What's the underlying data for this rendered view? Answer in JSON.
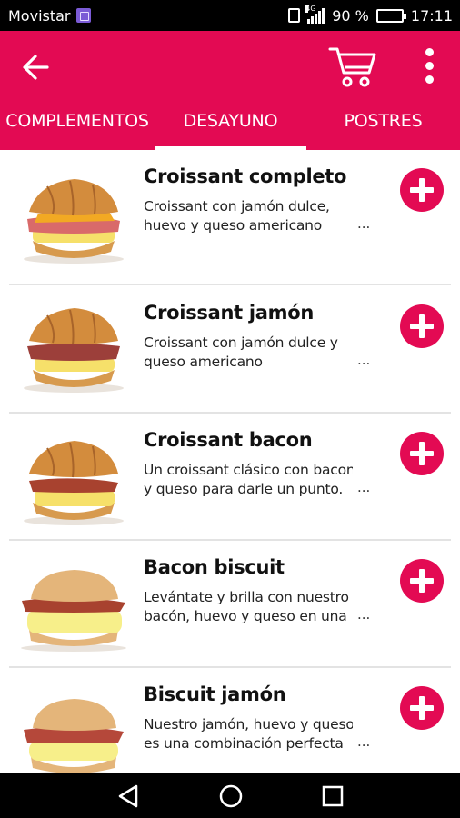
{
  "status_bar": {
    "carrier": "Movistar",
    "network_type": "4G",
    "battery_level": "90 %",
    "time": "17:11"
  },
  "app_bar": {
    "back_icon": "arrow-left",
    "cart_icon": "shopping-cart",
    "menu_icon": "more-vertical",
    "accent_color": "#e30a53"
  },
  "tabs": [
    {
      "label": "COMPLEMENTOS",
      "active": false
    },
    {
      "label": "DESAYUNO",
      "active": true
    },
    {
      "label": "POSTRES",
      "active": false
    }
  ],
  "products": [
    {
      "title": "Croissant completo",
      "desc_line1": "Croissant con jamón dulce,",
      "desc_line2": "huevo y queso americano",
      "ellipsis": "..."
    },
    {
      "title": "Croissant jamón",
      "desc_line1": "Croissant con jamón dulce y",
      "desc_line2": "queso americano",
      "ellipsis": "..."
    },
    {
      "title": "Croissant bacon",
      "desc_line1": "Un croissant clásico con bacon",
      "desc_line2": "y queso para darle un punto.",
      "ellipsis": "..."
    },
    {
      "title": "Bacon biscuit",
      "desc_line1": "Levántate y brilla con nuestro",
      "desc_line2": "bacón, huevo y queso en una",
      "ellipsis": "..."
    },
    {
      "title": "Biscuit jamón",
      "desc_line1": "Nuestro jamón, huevo y queso",
      "desc_line2": "es una combinación perfecta",
      "ellipsis": "..."
    }
  ],
  "nav_bar": {
    "back_icon": "triangle-back",
    "home_icon": "circle-home",
    "recents_icon": "square-recents"
  }
}
